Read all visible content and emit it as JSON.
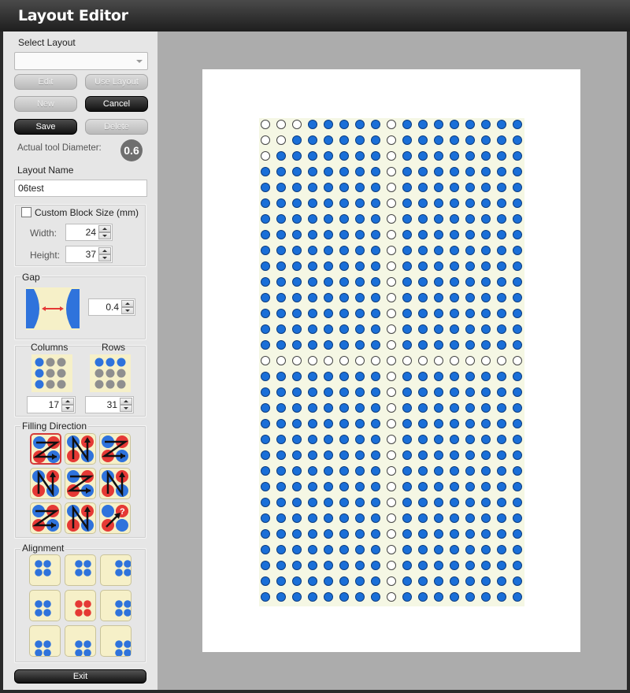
{
  "window": {
    "title": "Layout Editor"
  },
  "select_layout": {
    "label": "Select Layout",
    "value": ""
  },
  "buttons": {
    "edit": "Edit",
    "use_layout": "Use Layout",
    "new": "New",
    "cancel": "Cancel",
    "save": "Save",
    "delete": "Delete",
    "exit": "Exit"
  },
  "tool": {
    "label": "Actual tool Diameter:",
    "diameter": "0.6"
  },
  "layout_name": {
    "label": "Layout Name",
    "value": "06test"
  },
  "custom_block": {
    "label": "Custom Block Size (mm)",
    "checked": false,
    "width_label": "Width:",
    "width": "24",
    "height_label": "Height:",
    "height": "37"
  },
  "gap": {
    "label": "Gap",
    "value": "0.4"
  },
  "columns": {
    "label": "Columns",
    "value": "17"
  },
  "rows": {
    "label": "Rows",
    "value": "31"
  },
  "filling_direction": {
    "label": "Filling Direction",
    "selected_index": 0
  },
  "alignment": {
    "label": "Alignment",
    "selected_index": 4
  },
  "colors": {
    "filled": "#1a6fd8",
    "empty": "#ffffff",
    "accent_red": "#e53935",
    "tile_bg": "#f6f0c8"
  },
  "preview": {
    "columns": 17,
    "rows": 31,
    "empty_row_index": 15,
    "empty_col_index": 8,
    "empty_cells": [
      [
        0,
        0
      ],
      [
        0,
        1
      ],
      [
        0,
        2
      ],
      [
        1,
        0
      ],
      [
        1,
        1
      ],
      [
        2,
        0
      ]
    ]
  }
}
